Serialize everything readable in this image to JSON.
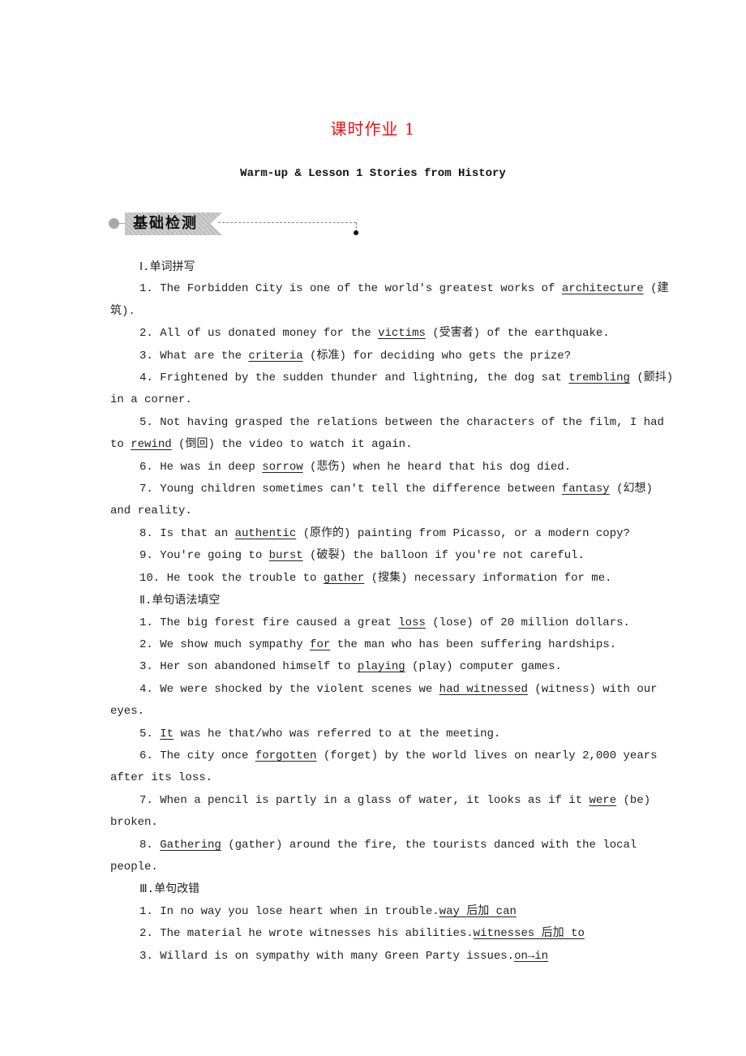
{
  "document": {
    "title": "课时作业 1",
    "subtitle": "Warm-up & Lesson 1 Stories from History",
    "title_color": "#ee1111",
    "section_banner": "基础检测"
  },
  "sections": [
    {
      "heading": "Ⅰ.单词拼写",
      "items": [
        {
          "segments": [
            {
              "t": "1. The Forbidden City is one of the world's greatest works of "
            },
            {
              "t": "architecture",
              "a": true
            },
            {
              "t": " (建筑)."
            }
          ]
        },
        {
          "segments": [
            {
              "t": "2. All of us donated money for the "
            },
            {
              "t": "victims",
              "a": true
            },
            {
              "t": " (受害者) of the earthquake."
            }
          ]
        },
        {
          "segments": [
            {
              "t": "3. What are the "
            },
            {
              "t": "criteria",
              "a": true
            },
            {
              "t": " (标准) for deciding who gets the prize?"
            }
          ]
        },
        {
          "segments": [
            {
              "t": "4. Frightened by the sudden thunder and lightning, the dog sat "
            },
            {
              "t": "trembling",
              "a": true
            },
            {
              "t": " (颤抖) in a corner."
            }
          ]
        },
        {
          "segments": [
            {
              "t": "5. Not having grasped the relations between the characters of the film, I had to "
            },
            {
              "t": "rewind",
              "a": true
            },
            {
              "t": " (倒回) the video to watch it again."
            }
          ]
        },
        {
          "segments": [
            {
              "t": "6. He was in deep "
            },
            {
              "t": "sorrow",
              "a": true
            },
            {
              "t": " (悲伤) when he heard that his dog died."
            }
          ]
        },
        {
          "segments": [
            {
              "t": "7. Young children sometimes can't tell the difference between "
            },
            {
              "t": "fantasy",
              "a": true
            },
            {
              "t": " (幻想) and reality."
            }
          ]
        },
        {
          "segments": [
            {
              "t": "8. Is that an "
            },
            {
              "t": "authentic",
              "a": true
            },
            {
              "t": " (原作的) painting from Picasso, or a modern copy?"
            }
          ]
        },
        {
          "segments": [
            {
              "t": "9. You're going to "
            },
            {
              "t": "burst",
              "a": true
            },
            {
              "t": " (破裂) the balloon if you're not careful."
            }
          ]
        },
        {
          "segments": [
            {
              "t": "10. He took the trouble to "
            },
            {
              "t": "gather",
              "a": true
            },
            {
              "t": " (搜集) necessary information for me."
            }
          ]
        }
      ]
    },
    {
      "heading": "Ⅱ.单句语法填空",
      "items": [
        {
          "segments": [
            {
              "t": "1. The big forest fire caused a great "
            },
            {
              "t": "loss",
              "a": true
            },
            {
              "t": " (lose) of 20 million dollars."
            }
          ]
        },
        {
          "segments": [
            {
              "t": "2. We show much sympathy "
            },
            {
              "t": "for",
              "a": true
            },
            {
              "t": " the man who has been suffering hardships."
            }
          ]
        },
        {
          "segments": [
            {
              "t": "3. Her son abandoned himself to "
            },
            {
              "t": "playing",
              "a": true
            },
            {
              "t": " (play) computer games."
            }
          ]
        },
        {
          "segments": [
            {
              "t": "4. We were shocked by the violent scenes we "
            },
            {
              "t": "had witnessed",
              "a": true
            },
            {
              "t": " (witness) with our eyes."
            }
          ]
        },
        {
          "segments": [
            {
              "t": "5. "
            },
            {
              "t": "It",
              "a": true
            },
            {
              "t": " was he that/who was referred to at the meeting."
            }
          ]
        },
        {
          "segments": [
            {
              "t": "6. The city once "
            },
            {
              "t": "forgotten",
              "a": true
            },
            {
              "t": " (forget) by the world lives on nearly 2,000 years after its loss."
            }
          ]
        },
        {
          "segments": [
            {
              "t": "7. When a pencil is partly in a glass of water, it looks as if it "
            },
            {
              "t": "were",
              "a": true
            },
            {
              "t": " (be) broken."
            }
          ]
        },
        {
          "segments": [
            {
              "t": "8. "
            },
            {
              "t": "Gathering",
              "a": true
            },
            {
              "t": " (gather) around the fire, the tourists danced with the local people."
            }
          ]
        }
      ]
    },
    {
      "heading": "Ⅲ.单句改错",
      "items": [
        {
          "segments": [
            {
              "t": "1. In no way you lose heart when in trouble."
            },
            {
              "t": "way 后加 can",
              "a": true
            }
          ]
        },
        {
          "segments": [
            {
              "t": "2. The material he wrote witnesses his abilities."
            },
            {
              "t": "witnesses 后加 to",
              "a": true
            }
          ]
        },
        {
          "segments": [
            {
              "t": "3. Willard is on sympathy with many Green Party issues."
            },
            {
              "t": "on→in",
              "a": true
            }
          ]
        }
      ]
    }
  ]
}
